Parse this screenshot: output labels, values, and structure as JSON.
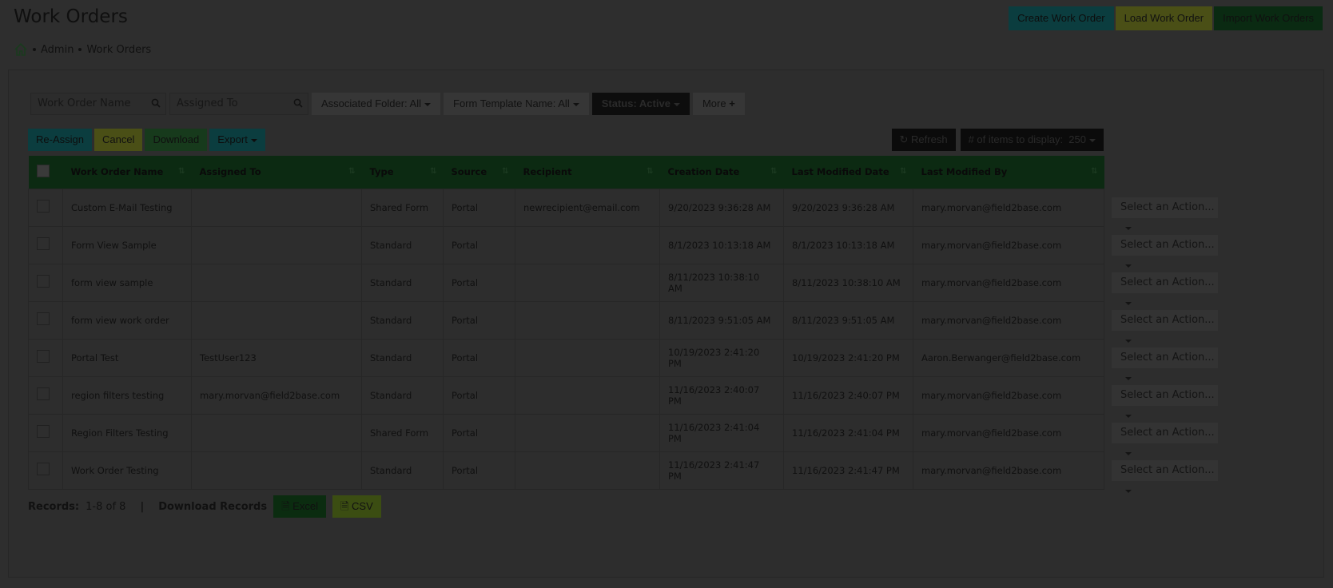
{
  "page": {
    "title": "Work Orders"
  },
  "header_buttons": {
    "create": "Create Work Order",
    "load": "Load Work Order",
    "import": "Import Work Orders"
  },
  "breadcrumb": [
    "Admin",
    "Work Orders"
  ],
  "filters": {
    "work_order_name_placeholder": "Work Order Name",
    "assigned_to_placeholder": "Assigned To",
    "associated_folder": "Associated Folder: All",
    "form_template": "Form Template Name: All",
    "status": "Status: Active",
    "more": "More"
  },
  "bulk_actions": {
    "reassign": "Re-Assign",
    "cancel": "Cancel",
    "download": "Download",
    "export": "Export"
  },
  "tools": {
    "refresh": "Refresh",
    "items_label": "# of items to display:",
    "items_value": "250"
  },
  "table": {
    "headers": [
      "Work Order Name",
      "Assigned To",
      "Type",
      "Source",
      "Recipient",
      "Creation Date",
      "Last Modified Date",
      "Last Modified By"
    ],
    "rows": [
      [
        "Custom E-Mail Testing",
        "",
        "Shared Form",
        "Portal",
        "newrecipient@email.com",
        "9/20/2023 9:36:28 AM",
        "9/20/2023 9:36:28 AM",
        "mary.morvan@field2base.com"
      ],
      [
        "Form View Sample",
        "",
        "Standard",
        "Portal",
        "",
        "8/1/2023 10:13:18 AM",
        "8/1/2023 10:13:18 AM",
        "mary.morvan@field2base.com"
      ],
      [
        "form view sample",
        "",
        "Standard",
        "Portal",
        "",
        "8/11/2023 10:38:10 AM",
        "8/11/2023 10:38:10 AM",
        "mary.morvan@field2base.com"
      ],
      [
        "form view work order",
        "",
        "Standard",
        "Portal",
        "",
        "8/11/2023 9:51:05 AM",
        "8/11/2023 9:51:05 AM",
        "mary.morvan@field2base.com"
      ],
      [
        "Portal Test",
        "TestUser123",
        "Standard",
        "Portal",
        "",
        "10/19/2023 2:41:20 PM",
        "10/19/2023 2:41:20 PM",
        "Aaron.Berwanger@field2base.com"
      ],
      [
        "region filters testing",
        "mary.morvan@field2base.com",
        "Standard",
        "Portal",
        "",
        "11/16/2023 2:40:07 PM",
        "11/16/2023 2:40:07 PM",
        "mary.morvan@field2base.com"
      ],
      [
        "Region Filters Testing",
        "",
        "Shared Form",
        "Portal",
        "",
        "11/16/2023 2:41:04 PM",
        "11/16/2023 2:41:04 PM",
        "mary.morvan@field2base.com"
      ],
      [
        "Work Order Testing",
        "",
        "Standard",
        "Portal",
        "",
        "11/16/2023 2:41:47 PM",
        "11/16/2023 2:41:47 PM",
        "mary.morvan@field2base.com"
      ]
    ],
    "row_action_label": "Select an Action..."
  },
  "footer": {
    "records_label": "Records:",
    "records_value": "1-8 of 8",
    "separator": "|",
    "download_label": "Download Records",
    "excel": "Excel",
    "csv": "CSV"
  }
}
